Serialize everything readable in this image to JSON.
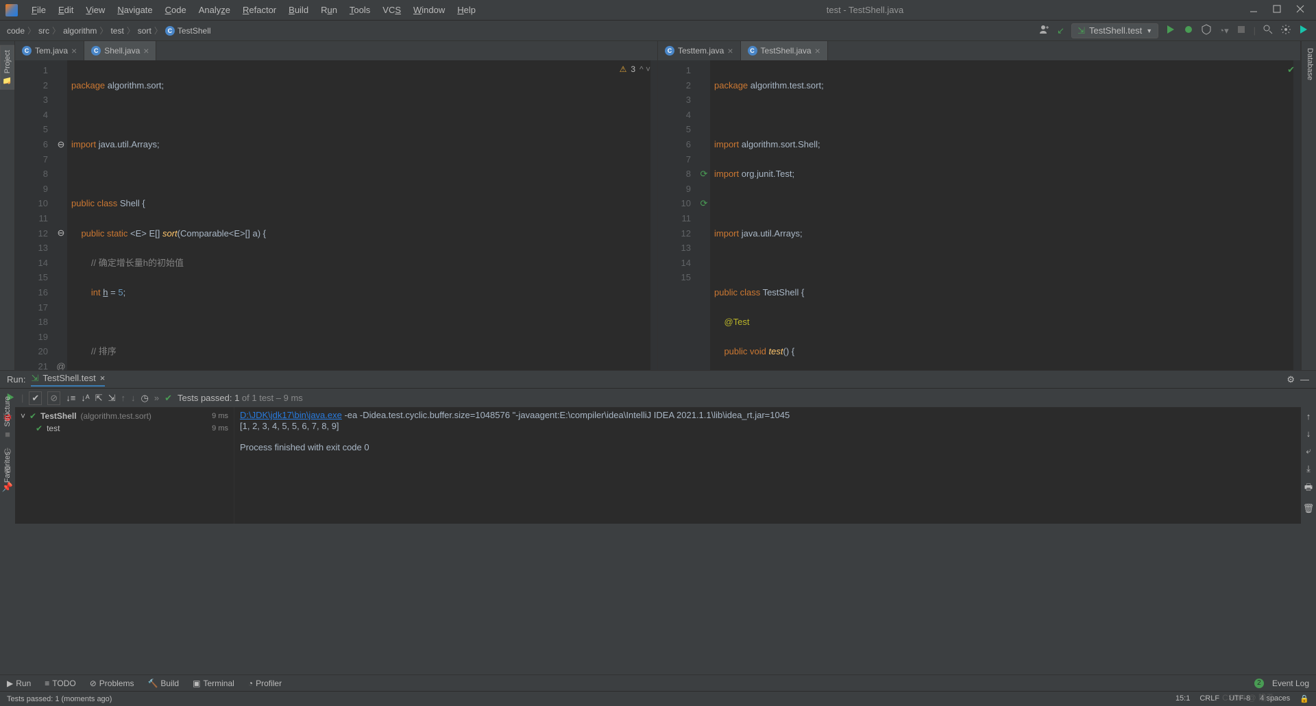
{
  "window": {
    "title": "test - TestShell.java"
  },
  "menus": [
    "File",
    "Edit",
    "View",
    "Navigate",
    "Code",
    "Analyze",
    "Refactor",
    "Build",
    "Run",
    "Tools",
    "VCS",
    "Window",
    "Help"
  ],
  "breadcrumb": [
    "code",
    "src",
    "algorithm",
    "test",
    "sort",
    "TestShell"
  ],
  "runConfig": "TestShell.test",
  "leftTabs": [
    "Project"
  ],
  "rightTabs": [
    "Database"
  ],
  "leftPane": {
    "tabs": [
      {
        "label": "Tem.java",
        "active": false
      },
      {
        "label": "Shell.java",
        "active": true
      }
    ],
    "warnings": "3",
    "lines": [
      "1",
      "2",
      "3",
      "4",
      "5",
      "6",
      "7",
      "8",
      "9",
      "10",
      "11",
      "12",
      "13",
      "14",
      "15",
      "16",
      "17",
      "18",
      "19",
      "20",
      "21"
    ]
  },
  "rightPane": {
    "tabs": [
      {
        "label": "Testtem.java",
        "active": false
      },
      {
        "label": "TestShell.java",
        "active": true
      }
    ],
    "lines": [
      "1",
      "2",
      "3",
      "4",
      "5",
      "6",
      "7",
      "8",
      "9",
      "10",
      "11",
      "12",
      "13",
      "14",
      "15"
    ]
  },
  "runPanel": {
    "title": "Run:",
    "tab": "TestShell.test",
    "testsText": "Tests passed: 1",
    "testsOf": " of 1 test – 9 ms",
    "tree": {
      "root": "TestShell",
      "rootPkg": "(algorithm.test.sort)",
      "rootMs": "9 ms",
      "child": "test",
      "childMs": "9 ms"
    },
    "consoleLink": "D:\\JDK\\jdk17\\bin\\java.exe",
    "consoleArgs": " -ea -Didea.test.cyclic.buffer.size=1048576 \"-javaagent:E:\\compiler\\idea\\IntelliJ IDEA 2021.1.1\\lib\\idea_rt.jar=1045",
    "output": "[1, 2, 3, 4, 5, 5, 6, 7, 8, 9]",
    "exit": "Process finished with exit code 0"
  },
  "bottomTools": {
    "run": "Run",
    "todo": "TODO",
    "problems": "Problems",
    "build": "Build",
    "terminal": "Terminal",
    "profiler": "Profiler",
    "eventLog": "Event Log",
    "badge": "2"
  },
  "status": {
    "msg": "Tests passed: 1 (moments ago)",
    "pos": "15:1",
    "eol": "CRLF",
    "enc": "UTF-8",
    "indent": "4 spaces"
  },
  "sideTools": [
    "Structure",
    "Favorites"
  ],
  "watermark": "CSDN @ 瞻孔"
}
